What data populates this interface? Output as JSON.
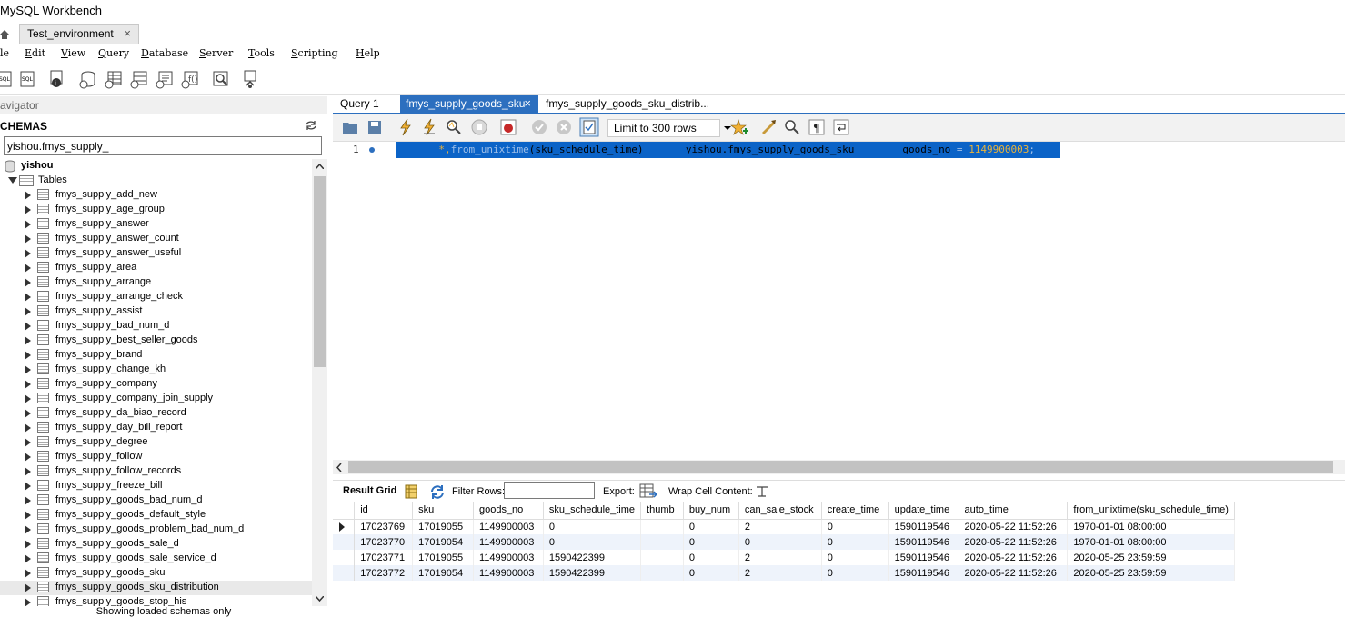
{
  "app_title": "MySQL Workbench",
  "connection_tab": {
    "label": "Test_environment",
    "close": "×"
  },
  "menu": [
    {
      "first": "",
      "rest": "le"
    },
    {
      "first": "E",
      "rest": "dit"
    },
    {
      "first": "V",
      "rest": "iew"
    },
    {
      "first": "Q",
      "rest": "uery"
    },
    {
      "first": "D",
      "rest": "atabase"
    },
    {
      "first": "S",
      "rest": "erver"
    },
    {
      "first": "T",
      "rest": "ools"
    },
    {
      "first": "S",
      "rest": "cripting"
    },
    {
      "first": "H",
      "rest": "elp"
    }
  ],
  "navigator": {
    "header": "avigator",
    "schemas_label": "CHEMAS",
    "filter_value": "yishou.fmys_supply_",
    "schema_name": "yishou",
    "tables_label": "Tables",
    "tables": [
      "fmys_supply_add_new",
      "fmys_supply_age_group",
      "fmys_supply_answer",
      "fmys_supply_answer_count",
      "fmys_supply_answer_useful",
      "fmys_supply_area",
      "fmys_supply_arrange",
      "fmys_supply_arrange_check",
      "fmys_supply_assist",
      "fmys_supply_bad_num_d",
      "fmys_supply_best_seller_goods",
      "fmys_supply_brand",
      "fmys_supply_change_kh",
      "fmys_supply_company",
      "fmys_supply_company_join_supply",
      "fmys_supply_da_biao_record",
      "fmys_supply_day_bill_report",
      "fmys_supply_degree",
      "fmys_supply_follow",
      "fmys_supply_follow_records",
      "fmys_supply_freeze_bill",
      "fmys_supply_goods_bad_num_d",
      "fmys_supply_goods_default_style",
      "fmys_supply_goods_problem_bad_num_d",
      "fmys_supply_goods_sale_d",
      "fmys_supply_goods_sale_service_d",
      "fmys_supply_goods_sku",
      "fmys_supply_goods_sku_distribution",
      "fmys_supply_goods_stop_his"
    ],
    "footer": "Showing loaded schemas only"
  },
  "query_tabs": [
    {
      "label": "Query 1",
      "active": false
    },
    {
      "label": "fmys_supply_goods_sku",
      "active": true,
      "close": "×"
    },
    {
      "label": "fmys_supply_goods_sku_distrib...",
      "active": false
    }
  ],
  "limit_label": "Limit to 300 rows",
  "editor": {
    "line_number": "1",
    "sql_parts": [
      {
        "text": "       *,",
        "color": "#e8b23c"
      },
      {
        "text": "from_unixtime",
        "color": "#9fbfe8"
      },
      {
        "text": "(sku_schedule_time)",
        "color": "#000000"
      },
      {
        "text": "       ",
        "color": "#000000"
      },
      {
        "text": "yishou.fmys_supply_goods_sku",
        "color": "#000000"
      },
      {
        "text": "        ",
        "color": "#000000"
      },
      {
        "text": "goods_no",
        "color": "#000000"
      },
      {
        "text": " = ",
        "color": "#9fbfe8"
      },
      {
        "text": "1149900003",
        "color": "#e8b23c"
      },
      {
        "text": ";",
        "color": "#9fbfe8"
      }
    ]
  },
  "result_toolbar": {
    "result_grid": "Result Grid",
    "filter_rows": "Filter Rows:",
    "export": "Export:",
    "wrap": "Wrap Cell Content:"
  },
  "grid": {
    "columns": [
      "id",
      "sku",
      "goods_no",
      "sku_schedule_time",
      "thumb",
      "buy_num",
      "can_sale_stock",
      "create_time",
      "update_time",
      "auto_time",
      "from_unixtime(sku_schedule_time)"
    ],
    "rows": [
      [
        "17023769",
        "17019055",
        "1149900003",
        "0",
        "",
        "0",
        "2",
        "0",
        "1590119546",
        "2020-05-22 11:52:26",
        "1970-01-01 08:00:00"
      ],
      [
        "17023770",
        "17019054",
        "1149900003",
        "0",
        "",
        "0",
        "0",
        "0",
        "1590119546",
        "2020-05-22 11:52:26",
        "1970-01-01 08:00:00"
      ],
      [
        "17023771",
        "17019055",
        "1149900003",
        "1590422399",
        "",
        "0",
        "2",
        "0",
        "1590119546",
        "2020-05-22 11:52:26",
        "2020-05-25 23:59:59"
      ],
      [
        "17023772",
        "17019054",
        "1149900003",
        "1590422399",
        "",
        "0",
        "2",
        "0",
        "1590119546",
        "2020-05-22 11:52:26",
        "2020-05-25 23:59:59"
      ]
    ]
  },
  "colors": {
    "accent": "#2c6fbf",
    "selection": "#0b63c7"
  }
}
